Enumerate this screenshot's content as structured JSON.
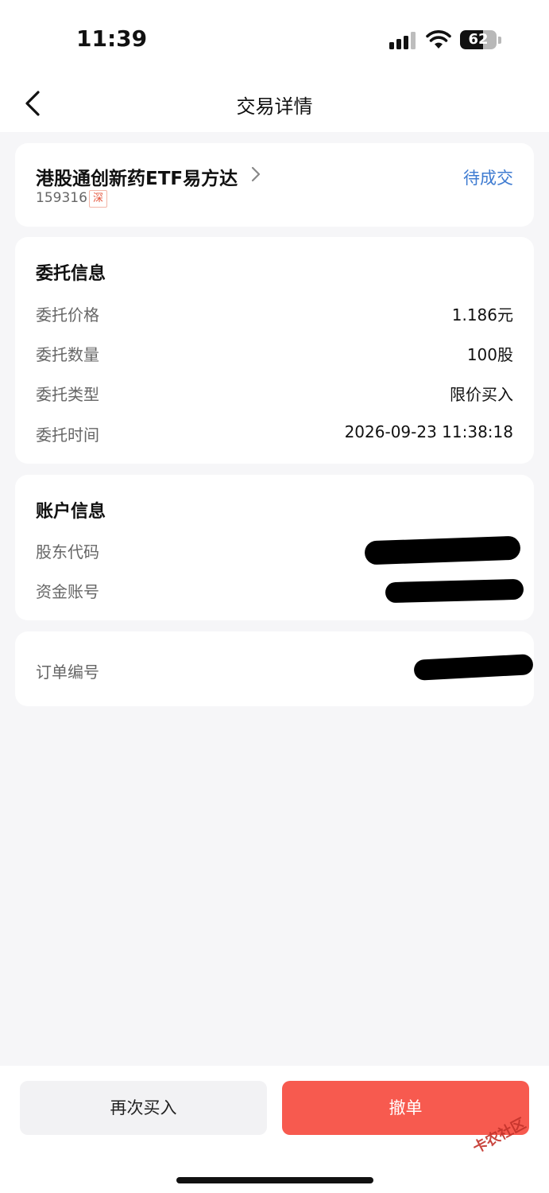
{
  "status_bar": {
    "time": "11:39",
    "battery": "62",
    "battery_level": 0.62
  },
  "nav": {
    "title": "交易详情"
  },
  "stock": {
    "name": "港股通创新药ETF易方达",
    "code": "159316",
    "market": "深",
    "status": "待成交"
  },
  "order_info": {
    "title": "委托信息",
    "rows": [
      {
        "label": "委托价格",
        "value": "1.186元"
      },
      {
        "label": "委托数量",
        "value": "100股"
      },
      {
        "label": "委托类型",
        "value": "限价买入"
      },
      {
        "label": "委托时间",
        "value": "2026-09-23 11:38:18"
      }
    ]
  },
  "account_info": {
    "title": "账户信息",
    "rows": [
      {
        "label": "股东代码"
      },
      {
        "label": "资金账号"
      }
    ]
  },
  "order_no": {
    "label": "订单编号"
  },
  "actions": {
    "rebuy": "再次买入",
    "cancel": "撤单"
  },
  "watermark": "卡农社区",
  "colors": {
    "accent_blue": "#3e7bd1",
    "cancel_red": "#f75a4f",
    "badge_red": "#e5553c"
  }
}
